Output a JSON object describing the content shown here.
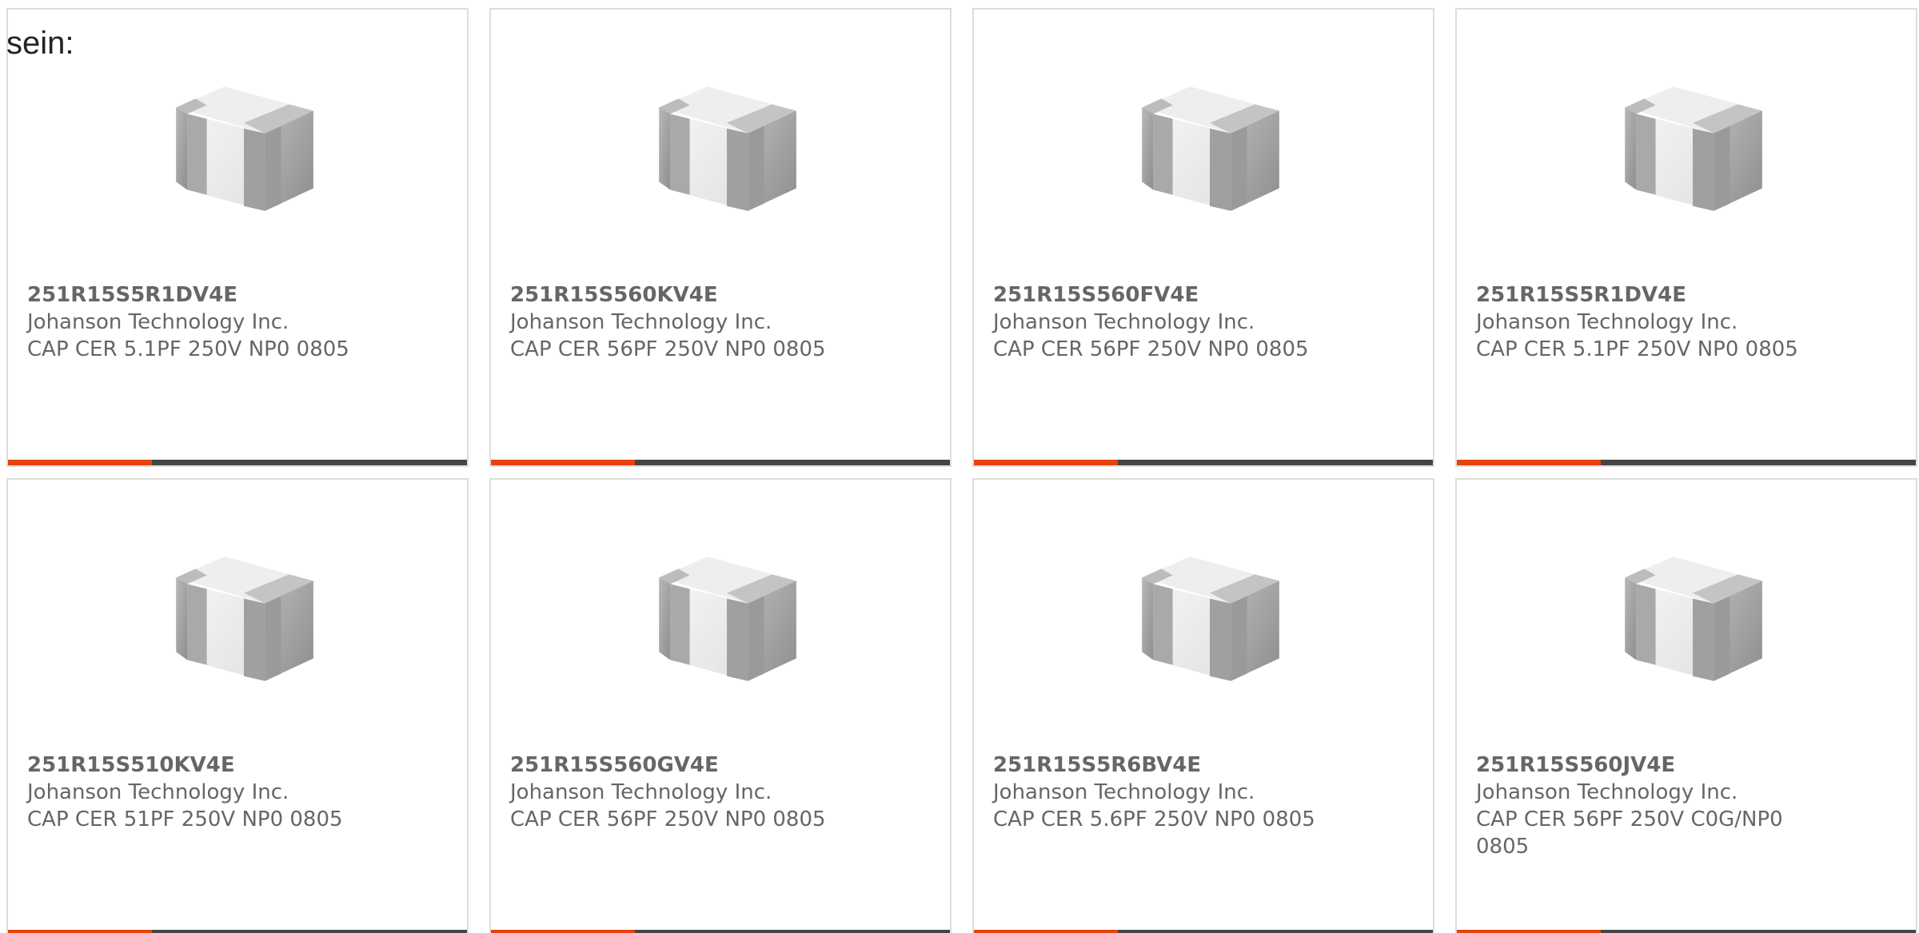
{
  "lead_text": "sein:",
  "accent_color": "#e8420e",
  "bar_color": "#444444",
  "products": [
    {
      "part_number": "251R15S5R1DV4E",
      "manufacturer": "Johanson Technology Inc.",
      "description": "CAP CER 5.1PF 250V NP0 0805"
    },
    {
      "part_number": "251R15S560KV4E",
      "manufacturer": "Johanson Technology Inc.",
      "description": "CAP CER 56PF 250V NP0 0805"
    },
    {
      "part_number": "251R15S560FV4E",
      "manufacturer": "Johanson Technology Inc.",
      "description": "CAP CER 56PF 250V NP0 0805"
    },
    {
      "part_number": "251R15S5R1DV4E",
      "manufacturer": "Johanson Technology Inc.",
      "description": "CAP CER 5.1PF 250V NP0 0805"
    },
    {
      "part_number": "251R15S510KV4E",
      "manufacturer": "Johanson Technology Inc.",
      "description": "CAP CER 51PF 250V NP0 0805"
    },
    {
      "part_number": "251R15S560GV4E",
      "manufacturer": "Johanson Technology Inc.",
      "description": "CAP CER 56PF 250V NP0 0805"
    },
    {
      "part_number": "251R15S5R6BV4E",
      "manufacturer": "Johanson Technology Inc.",
      "description": "CAP CER 5.6PF 250V NP0 0805"
    },
    {
      "part_number": "251R15S560JV4E",
      "manufacturer": "Johanson Technology Inc.",
      "description": "CAP CER 56PF 250V C0G/NP0 0805"
    }
  ]
}
